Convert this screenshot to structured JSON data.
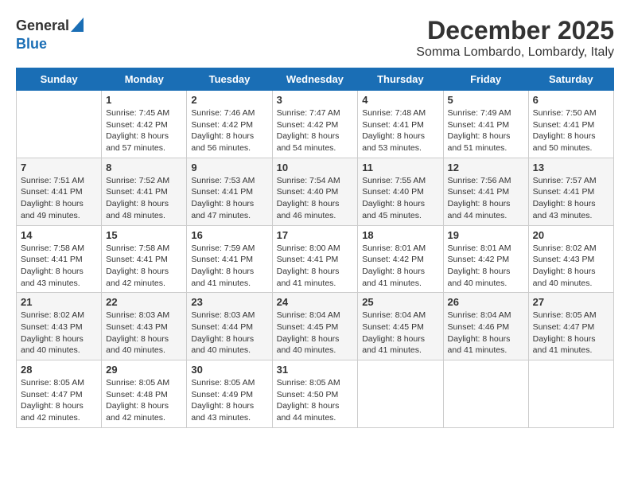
{
  "logo": {
    "general": "General",
    "blue": "Blue"
  },
  "title": "December 2025",
  "location": "Somma Lombardo, Lombardy, Italy",
  "days_of_week": [
    "Sunday",
    "Monday",
    "Tuesday",
    "Wednesday",
    "Thursday",
    "Friday",
    "Saturday"
  ],
  "weeks": [
    [
      {
        "day": "",
        "info": ""
      },
      {
        "day": "1",
        "sunrise": "Sunrise: 7:45 AM",
        "sunset": "Sunset: 4:42 PM",
        "daylight": "Daylight: 8 hours and 57 minutes."
      },
      {
        "day": "2",
        "sunrise": "Sunrise: 7:46 AM",
        "sunset": "Sunset: 4:42 PM",
        "daylight": "Daylight: 8 hours and 56 minutes."
      },
      {
        "day": "3",
        "sunrise": "Sunrise: 7:47 AM",
        "sunset": "Sunset: 4:42 PM",
        "daylight": "Daylight: 8 hours and 54 minutes."
      },
      {
        "day": "4",
        "sunrise": "Sunrise: 7:48 AM",
        "sunset": "Sunset: 4:41 PM",
        "daylight": "Daylight: 8 hours and 53 minutes."
      },
      {
        "day": "5",
        "sunrise": "Sunrise: 7:49 AM",
        "sunset": "Sunset: 4:41 PM",
        "daylight": "Daylight: 8 hours and 51 minutes."
      },
      {
        "day": "6",
        "sunrise": "Sunrise: 7:50 AM",
        "sunset": "Sunset: 4:41 PM",
        "daylight": "Daylight: 8 hours and 50 minutes."
      }
    ],
    [
      {
        "day": "7",
        "sunrise": "Sunrise: 7:51 AM",
        "sunset": "Sunset: 4:41 PM",
        "daylight": "Daylight: 8 hours and 49 minutes."
      },
      {
        "day": "8",
        "sunrise": "Sunrise: 7:52 AM",
        "sunset": "Sunset: 4:41 PM",
        "daylight": "Daylight: 8 hours and 48 minutes."
      },
      {
        "day": "9",
        "sunrise": "Sunrise: 7:53 AM",
        "sunset": "Sunset: 4:41 PM",
        "daylight": "Daylight: 8 hours and 47 minutes."
      },
      {
        "day": "10",
        "sunrise": "Sunrise: 7:54 AM",
        "sunset": "Sunset: 4:40 PM",
        "daylight": "Daylight: 8 hours and 46 minutes."
      },
      {
        "day": "11",
        "sunrise": "Sunrise: 7:55 AM",
        "sunset": "Sunset: 4:40 PM",
        "daylight": "Daylight: 8 hours and 45 minutes."
      },
      {
        "day": "12",
        "sunrise": "Sunrise: 7:56 AM",
        "sunset": "Sunset: 4:41 PM",
        "daylight": "Daylight: 8 hours and 44 minutes."
      },
      {
        "day": "13",
        "sunrise": "Sunrise: 7:57 AM",
        "sunset": "Sunset: 4:41 PM",
        "daylight": "Daylight: 8 hours and 43 minutes."
      }
    ],
    [
      {
        "day": "14",
        "sunrise": "Sunrise: 7:58 AM",
        "sunset": "Sunset: 4:41 PM",
        "daylight": "Daylight: 8 hours and 43 minutes."
      },
      {
        "day": "15",
        "sunrise": "Sunrise: 7:58 AM",
        "sunset": "Sunset: 4:41 PM",
        "daylight": "Daylight: 8 hours and 42 minutes."
      },
      {
        "day": "16",
        "sunrise": "Sunrise: 7:59 AM",
        "sunset": "Sunset: 4:41 PM",
        "daylight": "Daylight: 8 hours and 41 minutes."
      },
      {
        "day": "17",
        "sunrise": "Sunrise: 8:00 AM",
        "sunset": "Sunset: 4:41 PM",
        "daylight": "Daylight: 8 hours and 41 minutes."
      },
      {
        "day": "18",
        "sunrise": "Sunrise: 8:01 AM",
        "sunset": "Sunset: 4:42 PM",
        "daylight": "Daylight: 8 hours and 41 minutes."
      },
      {
        "day": "19",
        "sunrise": "Sunrise: 8:01 AM",
        "sunset": "Sunset: 4:42 PM",
        "daylight": "Daylight: 8 hours and 40 minutes."
      },
      {
        "day": "20",
        "sunrise": "Sunrise: 8:02 AM",
        "sunset": "Sunset: 4:43 PM",
        "daylight": "Daylight: 8 hours and 40 minutes."
      }
    ],
    [
      {
        "day": "21",
        "sunrise": "Sunrise: 8:02 AM",
        "sunset": "Sunset: 4:43 PM",
        "daylight": "Daylight: 8 hours and 40 minutes."
      },
      {
        "day": "22",
        "sunrise": "Sunrise: 8:03 AM",
        "sunset": "Sunset: 4:43 PM",
        "daylight": "Daylight: 8 hours and 40 minutes."
      },
      {
        "day": "23",
        "sunrise": "Sunrise: 8:03 AM",
        "sunset": "Sunset: 4:44 PM",
        "daylight": "Daylight: 8 hours and 40 minutes."
      },
      {
        "day": "24",
        "sunrise": "Sunrise: 8:04 AM",
        "sunset": "Sunset: 4:45 PM",
        "daylight": "Daylight: 8 hours and 40 minutes."
      },
      {
        "day": "25",
        "sunrise": "Sunrise: 8:04 AM",
        "sunset": "Sunset: 4:45 PM",
        "daylight": "Daylight: 8 hours and 41 minutes."
      },
      {
        "day": "26",
        "sunrise": "Sunrise: 8:04 AM",
        "sunset": "Sunset: 4:46 PM",
        "daylight": "Daylight: 8 hours and 41 minutes."
      },
      {
        "day": "27",
        "sunrise": "Sunrise: 8:05 AM",
        "sunset": "Sunset: 4:47 PM",
        "daylight": "Daylight: 8 hours and 41 minutes."
      }
    ],
    [
      {
        "day": "28",
        "sunrise": "Sunrise: 8:05 AM",
        "sunset": "Sunset: 4:47 PM",
        "daylight": "Daylight: 8 hours and 42 minutes."
      },
      {
        "day": "29",
        "sunrise": "Sunrise: 8:05 AM",
        "sunset": "Sunset: 4:48 PM",
        "daylight": "Daylight: 8 hours and 42 minutes."
      },
      {
        "day": "30",
        "sunrise": "Sunrise: 8:05 AM",
        "sunset": "Sunset: 4:49 PM",
        "daylight": "Daylight: 8 hours and 43 minutes."
      },
      {
        "day": "31",
        "sunrise": "Sunrise: 8:05 AM",
        "sunset": "Sunset: 4:50 PM",
        "daylight": "Daylight: 8 hours and 44 minutes."
      },
      {
        "day": "",
        "info": ""
      },
      {
        "day": "",
        "info": ""
      },
      {
        "day": "",
        "info": ""
      }
    ]
  ]
}
